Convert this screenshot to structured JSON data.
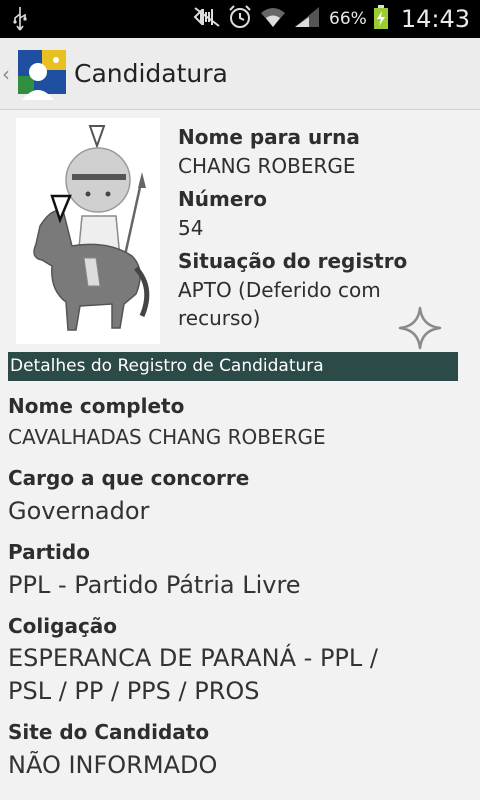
{
  "status_bar": {
    "battery_percent": "66%",
    "time": "14:43",
    "icons": [
      "usb-icon",
      "mute-icon",
      "alarm-icon",
      "wifi-icon",
      "signal-icon",
      "battery-charging-icon"
    ]
  },
  "action_bar": {
    "title": "Candidatura"
  },
  "candidate": {
    "ballot_name_label": "Nome para urna",
    "ballot_name": "CHANG ROBERGE",
    "number_label": "Número",
    "number": "54",
    "registration_status_label": "Situação do registro",
    "registration_status_line1": "APTO  (Deferido com",
    "registration_status_line2": "recurso)"
  },
  "section": {
    "title": "Detalhes do Registro de Candidatura"
  },
  "details": {
    "full_name_label": "Nome completo",
    "full_name": "CAVALHADAS CHANG ROBERGE",
    "office_label": "Cargo a que concorre",
    "office": "Governador",
    "party_label": "Partido",
    "party": "PPL - Partido Pátria Livre",
    "coalition_label": "Coligação",
    "coalition_line1": "ESPERANCA DE PARANÁ - PPL /",
    "coalition_line2": "PSL / PP / PPS / PROS",
    "website_label": "Site do Candidato",
    "website": "NÃO INFORMADO"
  },
  "colors": {
    "section_bar": "#2c4a47",
    "background": "#f2f2f2"
  }
}
